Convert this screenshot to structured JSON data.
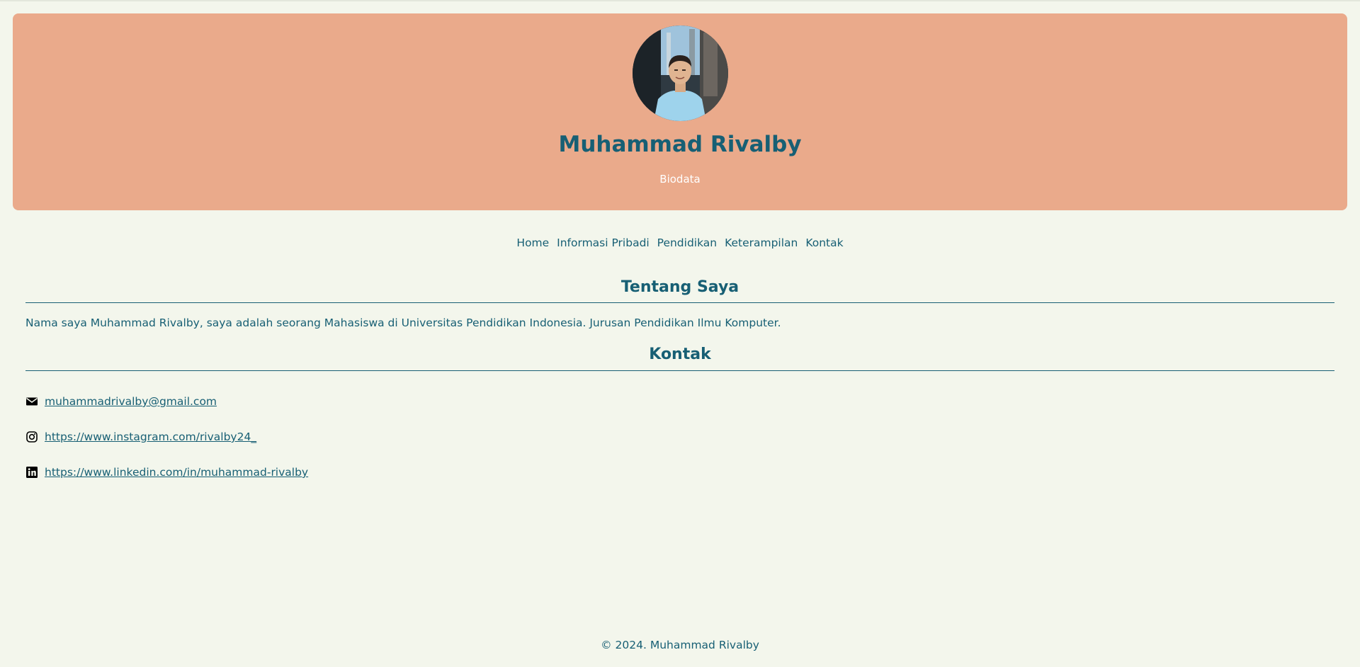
{
  "header": {
    "name": "Muhammad Rivalby",
    "subtitle": "Biodata",
    "avatar_icon": "profile-photo"
  },
  "nav": {
    "items": [
      {
        "label": "Home"
      },
      {
        "label": "Informasi Pribadi"
      },
      {
        "label": "Pendidikan"
      },
      {
        "label": "Keterampilan"
      },
      {
        "label": "Kontak"
      }
    ]
  },
  "about": {
    "title": "Tentang Saya",
    "text": "Nama saya Muhammad Rivalby, saya adalah seorang Mahasiswa di Universitas Pendidikan Indonesia. Jurusan Pendidikan Ilmu Komputer."
  },
  "contact": {
    "title": "Kontak",
    "items": [
      {
        "icon": "envelope-icon",
        "text": "muhammadrivalby@gmail.com"
      },
      {
        "icon": "instagram-icon",
        "text": "https://www.instagram.com/rivalby24_"
      },
      {
        "icon": "linkedin-icon",
        "text": "https://www.linkedin.com/in/muhammad-rivalby"
      }
    ]
  },
  "footer": {
    "text": "© 2024. Muhammad Rivalby"
  },
  "colors": {
    "background": "#f3f6ec",
    "header_bg": "#eaaa8b",
    "primary": "#175f74",
    "subtitle": "#ffffff"
  }
}
